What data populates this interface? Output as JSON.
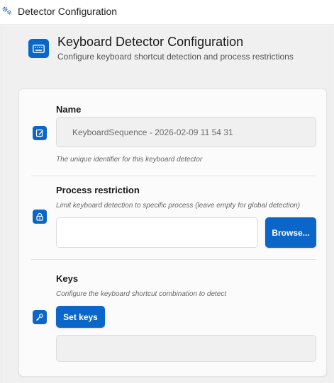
{
  "window": {
    "title": "Detector Configuration",
    "icon": "gears-icon"
  },
  "header": {
    "icon": "keyboard-icon",
    "title": "Keyboard Detector Configuration",
    "subtitle": "Configure keyboard shortcut detection and process restrictions"
  },
  "name_section": {
    "icon": "edit-icon",
    "label": "Name",
    "value": "KeyboardSequence - 2026-02-09 11 54 31",
    "hint": "The unique identifier for this keyboard detector"
  },
  "process_section": {
    "icon": "lock-icon",
    "label": "Process restriction",
    "hint": "Limit keyboard detection to specific process (leave empty for global detection)",
    "value": "",
    "browse_label": "Browse..."
  },
  "keys_section": {
    "icon": "key-icon",
    "label": "Keys",
    "hint": "Configure the keyboard shortcut combination to detect",
    "set_keys_label": "Set keys",
    "value": ""
  },
  "colors": {
    "accent": "#0a66c9",
    "background": "#f0f0f0",
    "card": "#fbfbfb"
  }
}
